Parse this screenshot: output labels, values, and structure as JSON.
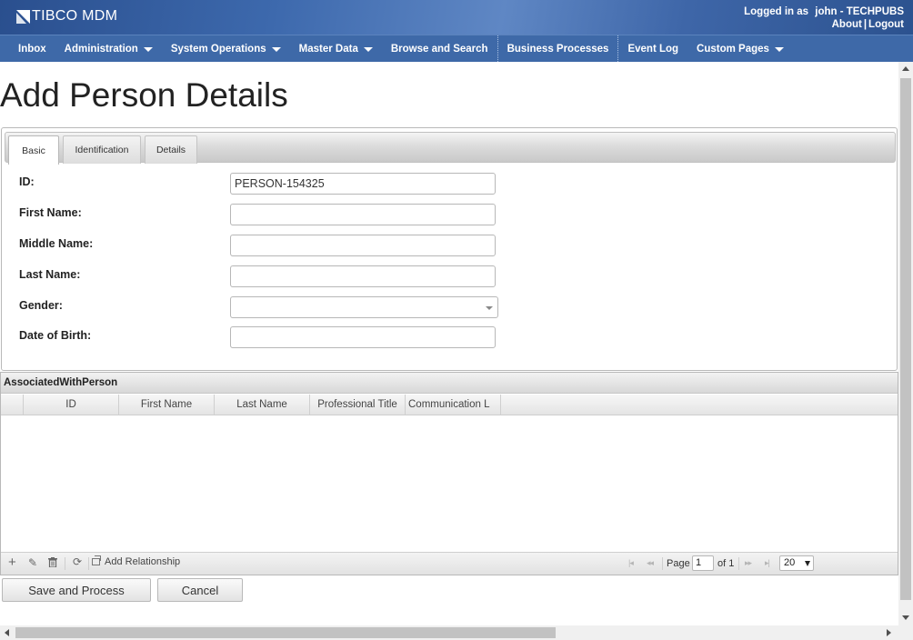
{
  "app": {
    "logo_text": "TIBCO MDM",
    "logged_in_label": "Logged in as",
    "user": "john - TECHPUBS",
    "about": "About",
    "separator": "|",
    "logout": "Logout"
  },
  "nav": {
    "items": [
      {
        "label": "Inbox",
        "dropdown": false
      },
      {
        "label": "Administration",
        "dropdown": true
      },
      {
        "label": "System Operations",
        "dropdown": true
      },
      {
        "label": "Master Data",
        "dropdown": true
      },
      {
        "label": "Browse and Search",
        "dropdown": false
      },
      {
        "label": "Business Processes",
        "dropdown": false,
        "active": true
      },
      {
        "label": "Event Log",
        "dropdown": false
      },
      {
        "label": "Custom Pages",
        "dropdown": true
      }
    ]
  },
  "page": {
    "title": "Add Person Details"
  },
  "tabs": [
    {
      "label": "Basic",
      "active": true
    },
    {
      "label": "Identification",
      "active": false
    },
    {
      "label": "Details",
      "active": false
    }
  ],
  "form": {
    "id_label": "ID:",
    "id_value": "PERSON-154325",
    "first_name_label": "First Name:",
    "first_name_value": "",
    "middle_name_label": "Middle Name:",
    "middle_name_value": "",
    "last_name_label": "Last Name:",
    "last_name_value": "",
    "gender_label": "Gender:",
    "gender_value": "",
    "dob_label": "Date of Birth:",
    "dob_value": ""
  },
  "grid": {
    "title": "AssociatedWithPerson",
    "columns": [
      "ID",
      "First Name",
      "Last Name",
      "Professional Title",
      "Communication L"
    ],
    "rows": [],
    "add_relationship": "Add Relationship",
    "page_label": "Page",
    "page_value": "1",
    "of_label": "of 1",
    "page_size": "20"
  },
  "buttons": {
    "save": "Save and Process",
    "cancel": "Cancel"
  },
  "colors": {
    "header_bg": "#3e69a8",
    "nav_text": "#ffffff"
  }
}
